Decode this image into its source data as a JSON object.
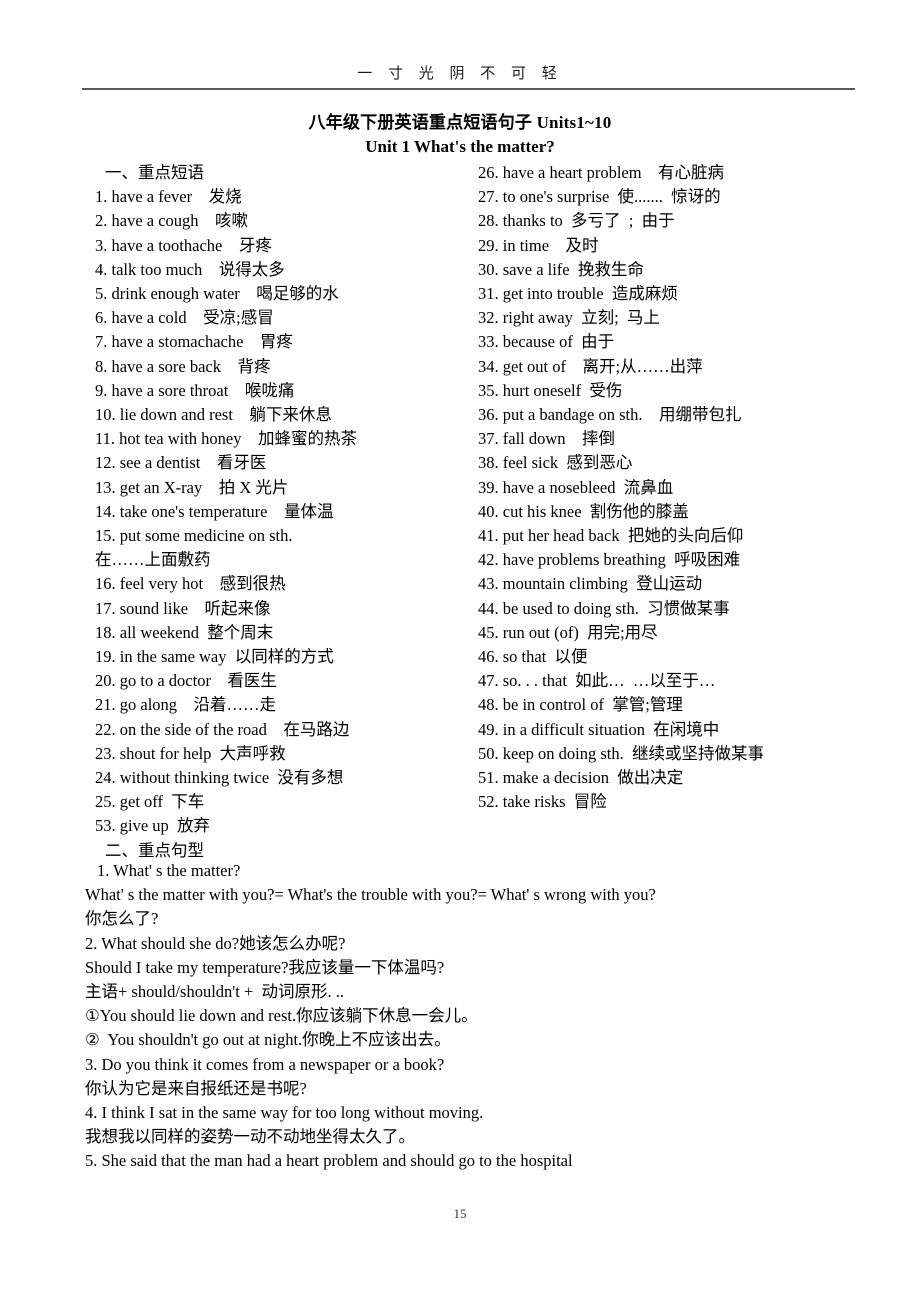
{
  "header": {
    "running_text": "一 寸 光 阴 不 可 轻"
  },
  "title": {
    "main": "八年级下册英语重点短语句子 Units1~10",
    "sub": "Unit 1 What's the matter?"
  },
  "sections": {
    "phrases_heading": "一、重点短语",
    "sentences_heading": "二、重点句型"
  },
  "phrases": {
    "left_column": [
      "一、重点短语",
      "1. have a fever    发烧",
      "2. have a cough    咳嗽",
      "3. have a toothache    牙疼",
      "4. talk too much    说得太多",
      "5. drink enough water    喝足够的水",
      "6. have a cold    受凉;感冒",
      "7. have a stomachache    胃疼",
      "8. have a sore back    背疼",
      "9. have a sore throat    喉咙痛",
      "10. lie down and rest    躺下来休息",
      "11. hot tea with honey    加蜂蜜的热茶",
      "12. see a dentist    看牙医",
      "13. get an X-ray    拍 X 光片",
      "14. take one's temperature    量体温",
      "15. put some medicine on sth.",
      "在……上面敷药",
      "16. feel very hot    感到很热",
      "17. sound like    听起来像",
      "18. all weekend  整个周末",
      "19. in the same way  以同样的方式",
      "20. go to a doctor    看医生",
      "21. go along    沿着……走",
      "22. on the side of the road    在马路边",
      "23. shout for help  大声呼救",
      "24. without thinking twice  没有多想",
      "25. get off  下车",
      "53. give up  放弃",
      "二、重点句型"
    ],
    "right_column": [
      "26. have a heart problem    有心脏病",
      "27. to one's surprise  使.......  惊讶的",
      "28. thanks to  多亏了  ;  由于",
      "29. in time    及时",
      "30. save a life  挽救生命",
      "31. get into trouble  造成麻烦",
      "32. right away  立刻;  马上",
      "33. because of  由于",
      "34. get out of    离开;从……出萍",
      "35. hurt oneself  受伤",
      "36. put a bandage on sth.    用绷带包扎",
      "37. fall down    摔倒",
      "38. feel sick  感到恶心",
      "39. have a nosebleed  流鼻血",
      "40. cut his knee  割伤他的膝盖",
      "41. put her head back  把她的头向后仰",
      "42. have problems breathing  呼吸困难",
      "43. mountain climbing  登山运动",
      "44. be used to doing sth.  习惯做某事",
      "45. run out (of)  用完;用尽",
      "46. so that  以便",
      "47. so. . . that  如此…  …以至于…",
      "48. be in control of  掌管;管理",
      "49. in a difficult situation  在闲境中",
      "50. keep on doing sth.  继续或坚持做某事",
      "51. make a decision  做出决定",
      "52. take risks  冒险"
    ]
  },
  "sentence_lines": [
    {
      "text": "1. What' s the matter?",
      "indent": true
    },
    {
      "text": "What' s the matter with you?= What's the trouble with you?= What' s wrong with you?",
      "indent": false
    },
    {
      "text": "你怎么了?",
      "indent": false
    },
    {
      "text": "2. What should she do?她该怎么办呢?",
      "indent": false
    },
    {
      "text": "Should I take my temperature?我应该量一下体温吗?",
      "indent": false
    },
    {
      "text": "主语+ should/shouldn't +  动词原形. ..",
      "indent": false
    },
    {
      "text": "①You should lie down and rest.你应该躺下休息一会儿。",
      "indent": false
    },
    {
      "text": "②  You shouldn't go out at night.你晚上不应该出去。",
      "indent": false
    },
    {
      "text": "3. Do you think it comes from a newspaper or a book?",
      "indent": false
    },
    {
      "text": "你认为它是来自报纸还是书呢?",
      "indent": false
    },
    {
      "text": "4. I think I sat in the same way for too long without moving.",
      "indent": false
    },
    {
      "text": "我想我以同样的姿势一动不动地坐得太久了。",
      "indent": false
    },
    {
      "text": "5. She said that the man had a heart problem and should go to the hospital",
      "indent": false
    }
  ],
  "footer": {
    "page_number": "15"
  },
  "colors": {
    "text": "#000000",
    "rule": "#595959",
    "background": "#ffffff"
  }
}
